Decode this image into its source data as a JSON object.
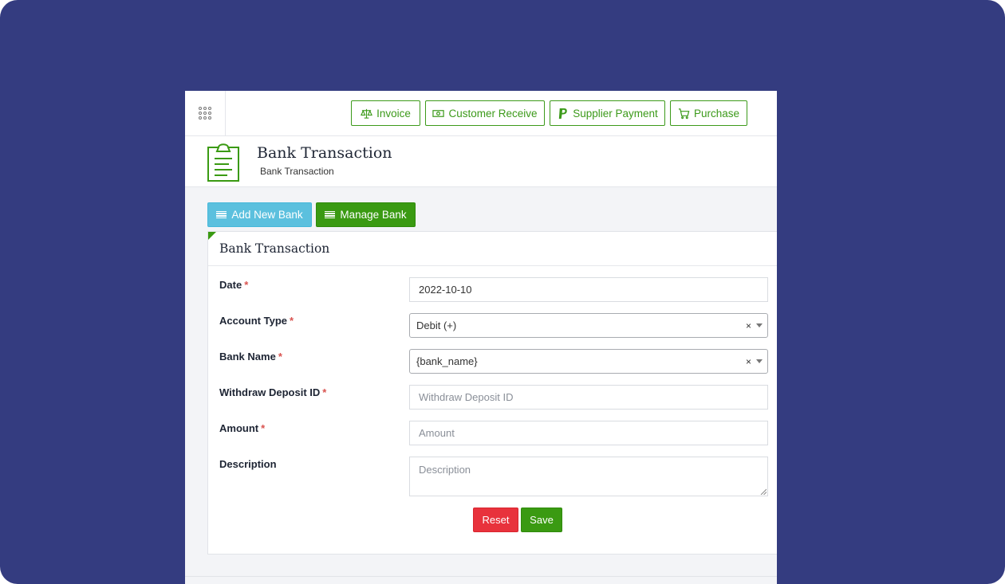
{
  "quick_actions": [
    {
      "label": "Invoice",
      "icon": "balance-scale-icon"
    },
    {
      "label": "Customer Receive",
      "icon": "money-bill-icon"
    },
    {
      "label": "Supplier Payment",
      "icon": "paypal-icon"
    },
    {
      "label": "Purchase",
      "icon": "shopping-cart-icon"
    }
  ],
  "header": {
    "title": "Bank Transaction",
    "subtitle": "Bank Transaction",
    "icon": "clipboard-icon"
  },
  "actions": {
    "add_new_bank": "Add New Bank",
    "manage_bank": "Manage Bank"
  },
  "form": {
    "title": "Bank Transaction",
    "date": {
      "label": "Date",
      "value": "2022-10-10"
    },
    "account_type": {
      "label": "Account Type",
      "value": "Debit (+)"
    },
    "bank_name": {
      "label": "Bank Name",
      "value": "{bank_name}"
    },
    "withdraw_deposit_id": {
      "label": "Withdraw Deposit ID",
      "placeholder": "Withdraw Deposit ID"
    },
    "amount": {
      "label": "Amount",
      "placeholder": "Amount"
    },
    "description": {
      "label": "Description",
      "placeholder": "Description"
    },
    "required_mark": "*",
    "clear_mark": "×",
    "reset": "Reset",
    "save": "Save"
  },
  "colors": {
    "background": "#343c80",
    "primary_green": "#3a9a12",
    "info_blue": "#5bc0de",
    "danger_red": "#e8323c"
  }
}
